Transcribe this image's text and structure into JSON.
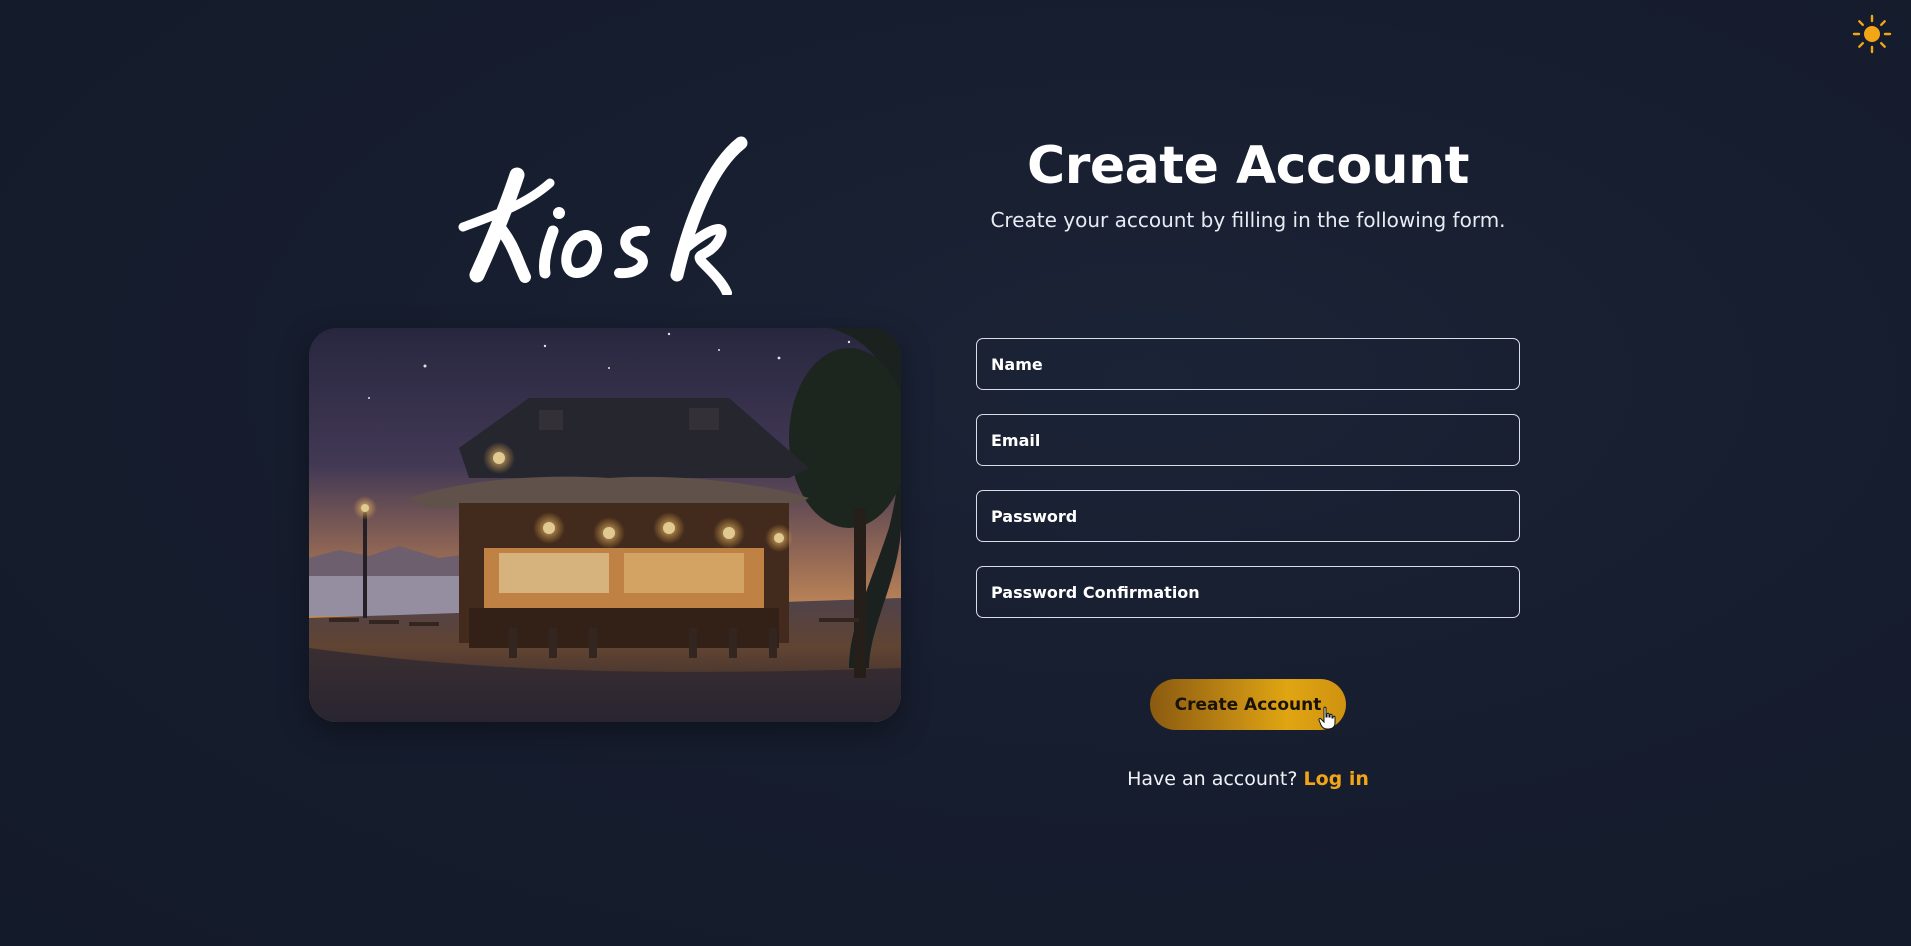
{
  "brand": {
    "logo_text": "Kiosk"
  },
  "theme_toggle": {
    "icon": "sun-icon",
    "color": "#f2a516"
  },
  "hero_image": {
    "description_icon": "cafe-kiosk-illustration"
  },
  "form": {
    "title": "Create Account",
    "subtitle": "Create your account by filling in the following form.",
    "fields": {
      "name_placeholder": "Name",
      "email_placeholder": "Email",
      "password_placeholder": "Password",
      "password_confirmation_placeholder": "Password Confirmation"
    },
    "submit_label": "Create Account"
  },
  "footer": {
    "prompt": "Have an account?",
    "login_label": "Log in"
  },
  "colors": {
    "background": "#161d2e",
    "accent": "#f2a516",
    "text": "#ffffff"
  }
}
